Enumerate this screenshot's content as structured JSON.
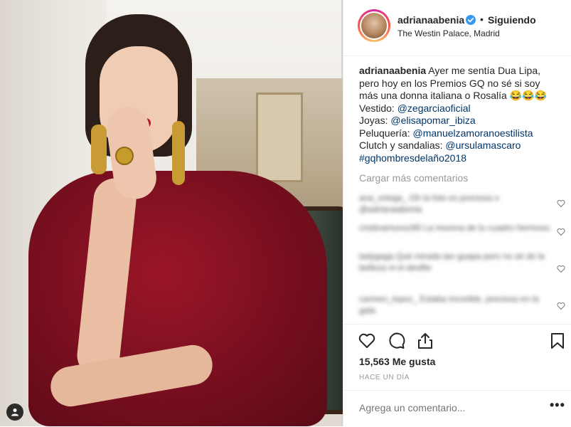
{
  "post": {
    "image_alt": "",
    "user_tag_icon": "person-icon"
  },
  "header": {
    "username": "adrianaabenia",
    "verified_icon": "verified-badge-icon",
    "separator": "•",
    "follow_status": "Siguiendo",
    "location": "The Westin Palace, Madrid"
  },
  "caption": {
    "username": "adrianaabenia",
    "line1": "Ayer me sentía Dua Lipa, pero hoy en los Premios GQ no sé si soy más una donna italiana o Rosalía 😂😂😂",
    "vestido_label": "Vestido: ",
    "vestido_link": "@zegarciaoficial",
    "joyas_label": "Joyas: ",
    "joyas_link": "@elisapomar_ibiza",
    "peluqueria_label": "Peluquería: ",
    "peluqueria_link": "@manuelzamoranoestilista",
    "clutch_label": "Clutch y sandalias: ",
    "clutch_link": "@ursulamascaro",
    "hashtag": "#gqhombresdelaño2018"
  },
  "load_more": "Cargar más comentarios",
  "comments": [
    "ana_ortega_ Oh la foto es preciosa x @adrianaabenia",
    "cristinamunoz90 La morena de tu cuadro hermoso",
    "ladygaga Qué mirada tan guapa pero no sé de la belleza ni el desfile",
    "carmen_lopez_ Estaba increíble, preciosa en la gala"
  ],
  "actions": {
    "like_icon": "heart-icon",
    "comment_icon": "comment-bubble-icon",
    "share_icon": "share-icon",
    "save_icon": "bookmark-icon"
  },
  "likes": "15,563 Me gusta",
  "time": "HACE UN DÍA",
  "comment_box": {
    "placeholder": "Agrega un comentario...",
    "more_options": "•••"
  },
  "colors": {
    "accent_link": "#003569",
    "verified": "#3897f0",
    "text": "#262626",
    "muted": "#999999",
    "border": "#efefef"
  }
}
